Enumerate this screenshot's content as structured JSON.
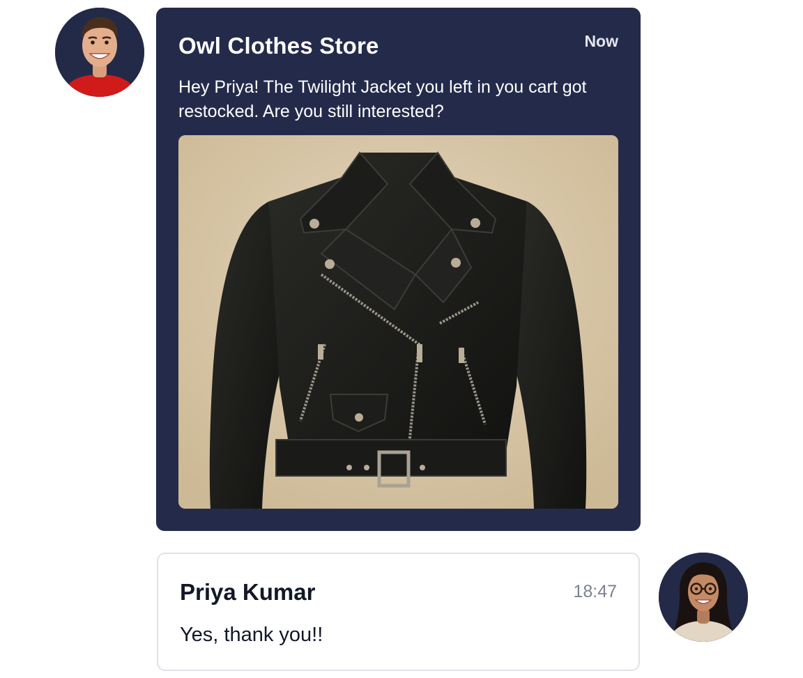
{
  "conversation": {
    "store_message": {
      "sender": "Owl Clothes Store",
      "time": "Now",
      "text": "Hey Priya! The Twilight Jacket you left in you cart got restocked. Are you still interested?",
      "image_icon": "leather-jacket-image",
      "avatar_icon": "store-agent-avatar"
    },
    "customer_message": {
      "sender": "Priya Kumar",
      "time": "18:47",
      "text": "Yes, thank you!!",
      "avatar_icon": "customer-avatar"
    }
  },
  "colors": {
    "store_bubble": "#242b4a",
    "avatar_bg": "#232a48",
    "customer_bubble_border": "#dfe2e8",
    "time_muted": "#7b8190"
  }
}
